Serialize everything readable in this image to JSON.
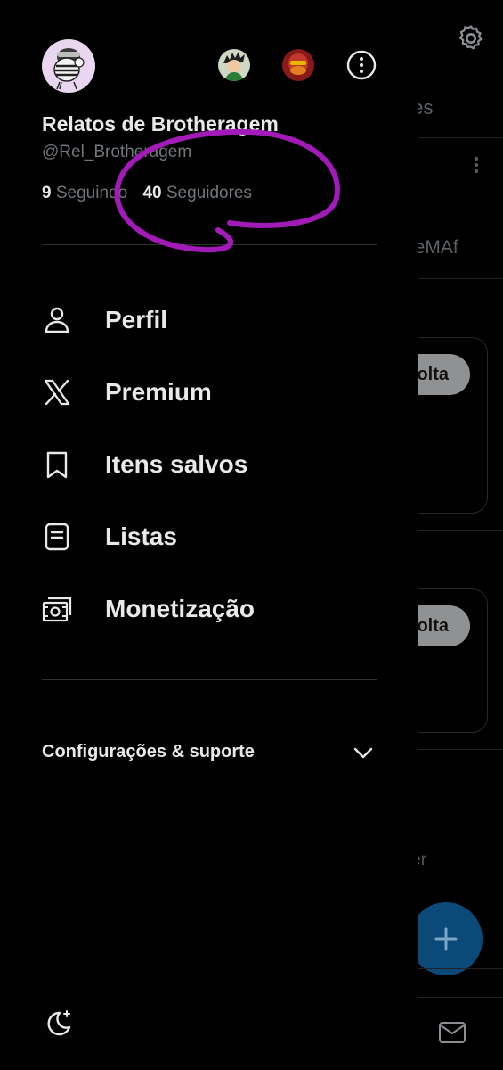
{
  "background": {
    "tab_fragment": "ções",
    "handle_fragment": "NJeMAf",
    "button_fragment_1": "olta",
    "button_fragment_2": "olta",
    "text_fragment": "ora ver",
    "icons": [
      "gear-icon",
      "more-vertical-icon",
      "plus-icon",
      "mail-icon"
    ]
  },
  "profile": {
    "display_name": "Relatos de Brotheragem",
    "handle": "@Rel_Brotheragem",
    "following_count": "9",
    "following_label": "Seguindo",
    "followers_count": "40",
    "followers_label": "Seguidores"
  },
  "menu": [
    {
      "label": "Perfil",
      "icon": "person-icon"
    },
    {
      "label": "Premium",
      "icon": "x-logo-icon"
    },
    {
      "label": "Itens salvos",
      "icon": "bookmark-icon"
    },
    {
      "label": "Listas",
      "icon": "list-icon"
    },
    {
      "label": "Monetização",
      "icon": "money-icon"
    }
  ],
  "settings": {
    "label": "Configurações & suporte",
    "icon": "chevron-down-icon"
  },
  "colors": {
    "background": "#000000",
    "text_primary": "#e7e9ea",
    "text_secondary": "#71767b",
    "divider": "#2f3336",
    "annotation": "#a21ab8"
  }
}
